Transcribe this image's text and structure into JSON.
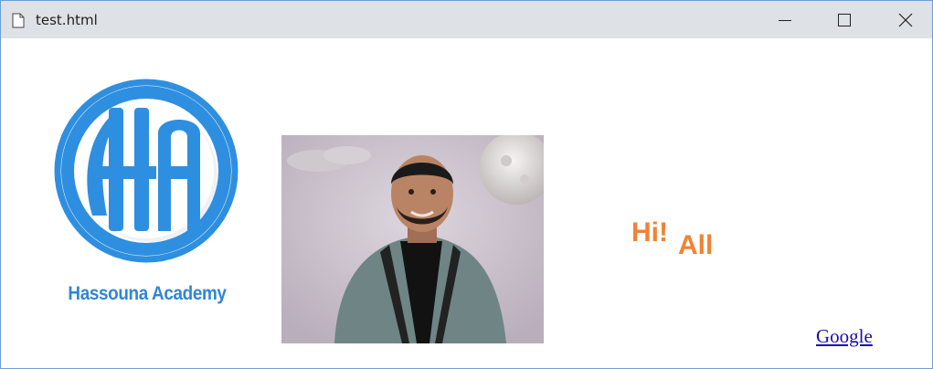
{
  "window": {
    "title": "test.html",
    "icons": {
      "document": "file-icon",
      "minimize": "minimize-icon",
      "maximize": "maximize-icon",
      "close": "close-icon"
    }
  },
  "page": {
    "logo": {
      "icon": "hassouna-academy-logo",
      "caption": "Hassouna Academy",
      "color": "#2e86d6"
    },
    "photo": {
      "icon": "person-portrait"
    },
    "greeting": {
      "hi": "Hi!",
      "all": "All",
      "color": "#f08334"
    },
    "link": {
      "text": "Google",
      "color": "#1a0dab"
    }
  }
}
